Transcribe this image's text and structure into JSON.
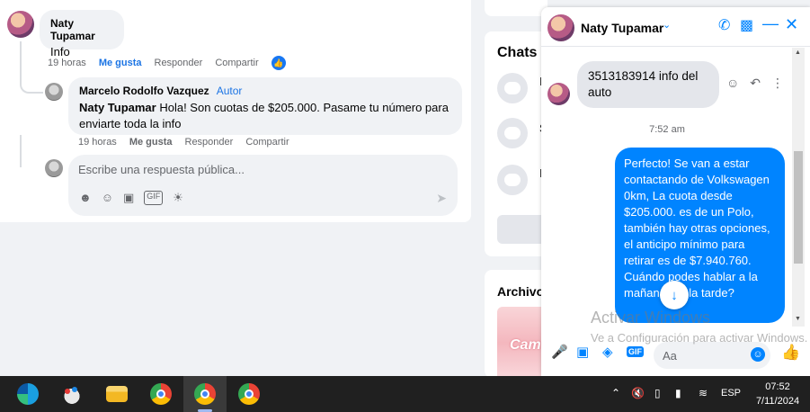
{
  "feed": {
    "comment": {
      "author": "Naty Tupamar",
      "text": "Info",
      "time": "19 horas",
      "like": "Me gusta",
      "reply": "Responder",
      "share": "Compartir"
    },
    "reply_comment": {
      "author": "Marcelo Rodolfo Vazquez",
      "badge": "Autor",
      "mention": "Naty Tupamar",
      "text": " Hola! Son cuotas de $205.000. Pasame tu número para enviarte toda la info",
      "time": "19 horas",
      "like": "Me gusta",
      "reply": "Responder",
      "share": "Compartir"
    },
    "reply_input": {
      "placeholder": "Escribe una respuesta pública..."
    }
  },
  "sidebar": {
    "chats_title": "Chats",
    "chat_letters": [
      "I",
      "S",
      "I"
    ],
    "archivos_title": "Archivos",
    "archivos_thumb_text": "Cam"
  },
  "messenger": {
    "contact_name": "Naty Tupamar",
    "incoming_message": "3513183914 info del auto",
    "timestamp": "7:52 am",
    "outgoing_message": "Perfecto!  Se van a estar contactando de Volkswagen 0km, La cuota desde $205.000. es de un Polo, también hay otras opciones, el anticipo mínimo para retirar es de $7.940.760. Cuándo podes hablar a la mañana o a la tarde?",
    "composer_placeholder": "Aa",
    "accent_color": "#0084ff"
  },
  "watermark": {
    "line1": "Activar Windows",
    "line2": "Ve a Configuración para activar Windows."
  },
  "taskbar": {
    "language": "ESP",
    "time": "07:52",
    "date": "7/11/2024"
  }
}
